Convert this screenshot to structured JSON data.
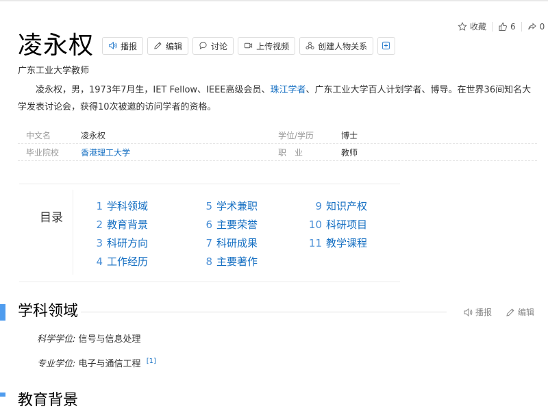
{
  "top_actions": {
    "collect_label": "收藏",
    "like_count": "6",
    "share_partial": "0"
  },
  "lemma": {
    "title": "凌永权",
    "subtitle": "广东工业大学教师",
    "buttons": {
      "broadcast": "播报",
      "edit": "编辑",
      "discuss": "讨论",
      "upload_video": "上传视频",
      "create_relation": "创建人物关系"
    }
  },
  "summary": {
    "part1": "凌永权，男，1973年7月生，IET Fellow、IEEE高级会员、",
    "link1": "珠江学者",
    "part2": "、广东工业大学百人计划学者、博导。在世界36间知名大学发表讨论会，获得10次被邀的访问学者的资格。"
  },
  "basic_info": [
    {
      "k1": "中文名",
      "v1": "凌永权",
      "k2": "学位/学历",
      "v2": "博士"
    },
    {
      "k1": "毕业院校",
      "v1": "香港理工大学",
      "k2": "职　业",
      "v2": "教师"
    }
  ],
  "catalog": {
    "title": "目录",
    "columns": [
      [
        {
          "num": "1",
          "label": "学科领域"
        },
        {
          "num": "2",
          "label": "教育背景"
        },
        {
          "num": "3",
          "label": "科研方向"
        },
        {
          "num": "4",
          "label": "工作经历"
        }
      ],
      [
        {
          "num": "5",
          "label": "学术兼职"
        },
        {
          "num": "6",
          "label": "主要荣誉"
        },
        {
          "num": "7",
          "label": "科研成果"
        },
        {
          "num": "8",
          "label": "主要著作"
        }
      ],
      [
        {
          "num": "9",
          "label": "知识产权"
        },
        {
          "num": "10",
          "label": "科研项目"
        },
        {
          "num": "11",
          "label": "教学课程"
        }
      ]
    ]
  },
  "section1": {
    "title": "学科领域",
    "broadcast": "播报",
    "edit": "编辑",
    "rows": [
      {
        "label": "科学学位:",
        "value": "信号与信息处理",
        "ref": ""
      },
      {
        "label": "专业学位:",
        "value": "电子与通信工程",
        "ref": "[1]"
      }
    ]
  },
  "section2": {
    "title": "教育背景"
  },
  "colors": {
    "link": "#136ec2",
    "accent": "#4f9cee"
  }
}
